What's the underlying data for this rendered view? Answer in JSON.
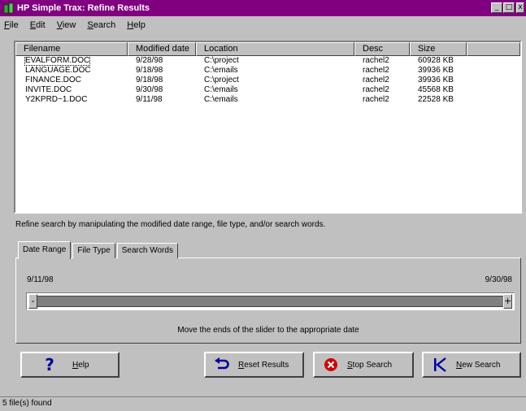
{
  "window": {
    "title": "HP Simple Trax: Refine Results",
    "minimize_glyph": "_",
    "maximize_glyph": "□",
    "close_glyph": "x"
  },
  "menu": [
    "File",
    "Edit",
    "View",
    "Search",
    "Help"
  ],
  "results": {
    "columns": [
      "Filename",
      "Modified date",
      "Location",
      "Desc",
      "Size"
    ],
    "rows": [
      {
        "filename": "EVALFORM.DOC",
        "modified": "9/28/98",
        "location": "C:\\project",
        "desc": "rachel2",
        "size": "60928 KB"
      },
      {
        "filename": "LANGUAGE.DOC",
        "modified": "9/18/98",
        "location": "C:\\emails",
        "desc": "rachel2",
        "size": "39936 KB"
      },
      {
        "filename": "FINANCE.DOC",
        "modified": "9/18/98",
        "location": "C:\\project",
        "desc": "rachel2",
        "size": "39936 KB"
      },
      {
        "filename": "INVITE.DOC",
        "modified": "9/30/98",
        "location": "C:\\emails",
        "desc": "rachel2",
        "size": "45568 KB"
      },
      {
        "filename": "Y2KPRD~1.DOC",
        "modified": "9/11/98",
        "location": "C:\\emails",
        "desc": "rachel2",
        "size": "22528 KB"
      }
    ]
  },
  "instructions": "Refine search by manipulating the modified date range, file type, and/or search words.",
  "tabs": [
    "Date Range",
    "File Type",
    "Search Words"
  ],
  "date_range": {
    "min_date": "9/11/98",
    "max_date": "9/30/98",
    "left_handle": "-",
    "right_handle": "+",
    "hint": "Move the ends of the slider to the appropriate date",
    "selected_fraction_start": 0,
    "selected_fraction_end": 1
  },
  "buttons": {
    "help": "Help",
    "help_icon": "?",
    "reset": "Reset Results",
    "stop": "Stop Search",
    "new": "New Search"
  },
  "status": "5 file(s) found",
  "colors": {
    "titlebar": "#800080",
    "face": "#c0c0c0",
    "help_icon": "#0000a0",
    "reset_icon": "#0000a0",
    "stop_icon": "#d40000",
    "new_icon": "#0000a0"
  }
}
